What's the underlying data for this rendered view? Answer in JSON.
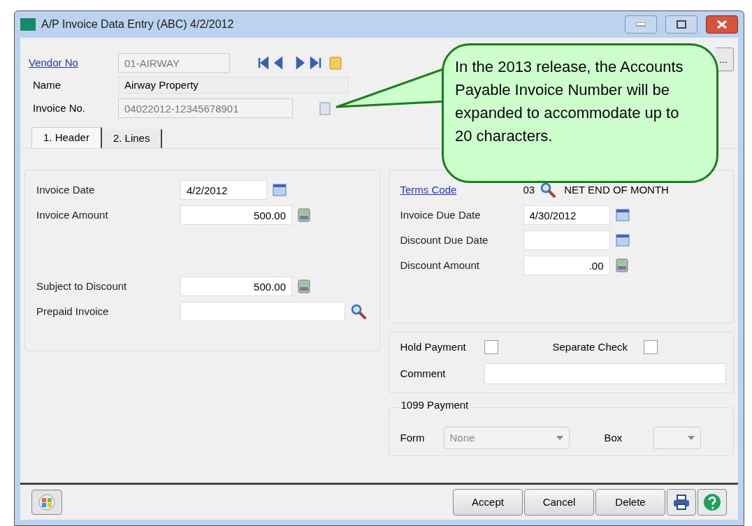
{
  "window": {
    "title": "A/P Invoice Data Entry (ABC) 4/2/2012"
  },
  "vendor": {
    "vendor_no_label": "Vendor No",
    "vendor_no": "01-AIRWAY",
    "name_label": "Name",
    "name": "Airway Property",
    "invoice_no_label": "Invoice No.",
    "invoice_no": "04022012-12345678901",
    "more_button": "..."
  },
  "tabs": [
    {
      "label": "1. Header",
      "selected": true
    },
    {
      "label": "2. Lines",
      "selected": false
    }
  ],
  "left_fields": [
    {
      "label": "Invoice Date",
      "value": "4/2/2012",
      "kind": "date"
    },
    {
      "label": "Invoice Amount",
      "value": "500.00",
      "kind": "amount"
    },
    {
      "label": "Subject to Discount",
      "value": "500.00",
      "kind": "amount"
    },
    {
      "label": "Prepaid Invoice",
      "kind": "lookup"
    }
  ],
  "terms": {
    "label": "Terms Code",
    "code": "03",
    "description": "NET END OF MONTH"
  },
  "right_fields": [
    {
      "label": "Invoice Due Date",
      "value": "4/30/2012",
      "kind": "date"
    },
    {
      "label": "Discount Due Date",
      "kind": "date"
    },
    {
      "label": "Discount Amount",
      "value": ".00",
      "kind": "amount"
    }
  ],
  "hold_payment": {
    "label": "Hold Payment",
    "checked": false
  },
  "separate_check": {
    "label": "Separate Check",
    "checked": false
  },
  "comment": {
    "label": "Comment"
  },
  "payment_1099": {
    "title": "1099 Payment",
    "form_label": "Form",
    "form_value": "None",
    "box_label": "Box"
  },
  "buttons": [
    "Accept",
    "Cancel",
    "Delete"
  ],
  "callout": "In the 2013 release, the Accounts Payable Invoice Number will be expanded to accommodate up to 20 characters."
}
